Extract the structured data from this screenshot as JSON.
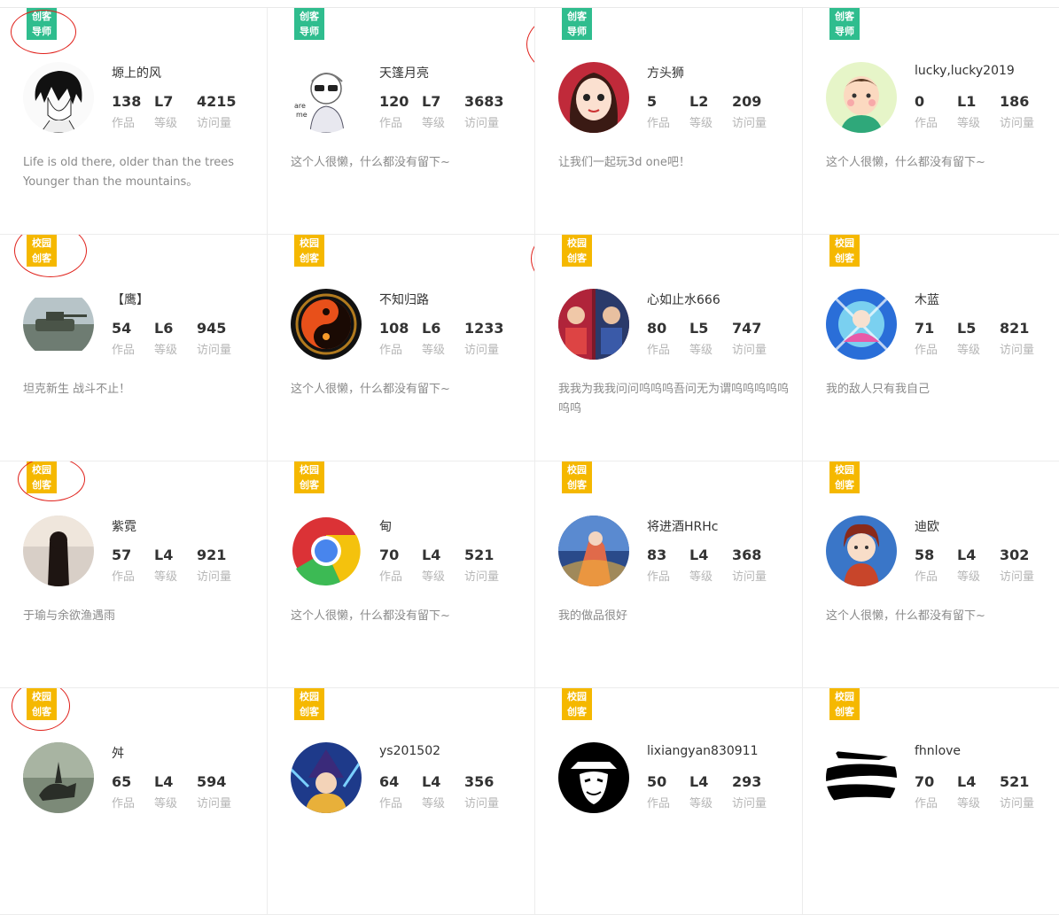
{
  "stat_labels": {
    "works": "作品",
    "level": "等级",
    "visits": "访问量"
  },
  "colors": {
    "mentor_badge": "#2fbd8e",
    "campus_badge": "#f5b800",
    "highlight_ring": "#e0211b"
  },
  "cards": [
    {
      "badge": [
        "创客",
        "导师"
      ],
      "badge_type": "mentor",
      "name": "塬上的风",
      "works": "138",
      "level": "L7",
      "visits": "4215",
      "bio": "Life is old there, older than the trees Younger than the mountains。",
      "avatar": "anime-boy"
    },
    {
      "badge": [
        "创客",
        "导师"
      ],
      "badge_type": "mentor",
      "name": "天篷月亮",
      "works": "120",
      "level": "L7",
      "visits": "3683",
      "bio": "这个人很懒，什么都没有留下~",
      "avatar": "sketch-glasses"
    },
    {
      "badge": [
        "创客",
        "导师"
      ],
      "badge_type": "mentor",
      "name": "方头狮",
      "works": "5",
      "level": "L2",
      "visits": "209",
      "bio": "让我们一起玩3d one吧！",
      "avatar": "cartoon-girl"
    },
    {
      "badge": [
        "创客",
        "导师"
      ],
      "badge_type": "mentor",
      "name": "lucky,lucky2019",
      "works": "0",
      "level": "L1",
      "visits": "186",
      "bio": "这个人很懒，什么都没有留下~",
      "avatar": "cartoon-boy"
    },
    {
      "badge": [
        "校园",
        "创客"
      ],
      "badge_type": "campus",
      "name": "【鹰】",
      "works": "54",
      "level": "L6",
      "visits": "945",
      "bio": "坦克新生 战斗不止！",
      "avatar": "tank"
    },
    {
      "badge": [
        "校园",
        "创客"
      ],
      "badge_type": "campus",
      "name": "不知归路",
      "works": "108",
      "level": "L6",
      "visits": "1233",
      "bio": "这个人很懒，什么都没有留下~",
      "avatar": "fire-yinyang"
    },
    {
      "badge": [
        "校园",
        "创客"
      ],
      "badge_type": "campus",
      "name": "心如止水666",
      "works": "80",
      "level": "L5",
      "visits": "747",
      "bio": "我我为我我问问呜呜呜吾问无为谓呜呜呜呜呜呜呜",
      "avatar": "game-poster"
    },
    {
      "badge": [
        "校园",
        "创客"
      ],
      "badge_type": "campus",
      "name": "木蓝",
      "works": "71",
      "level": "L5",
      "visits": "821",
      "bio": "我的敌人只有我自己",
      "avatar": "blue-anime"
    },
    {
      "badge": [
        "校园",
        "创客"
      ],
      "badge_type": "campus",
      "name": "紫霓",
      "works": "57",
      "level": "L4",
      "visits": "921",
      "bio": "于瑜与余欲渔遇雨",
      "avatar": "girl-back"
    },
    {
      "badge": [
        "校园",
        "创客"
      ],
      "badge_type": "campus",
      "name": "甸",
      "works": "70",
      "level": "L4",
      "visits": "521",
      "bio": "这个人很懒，什么都没有留下~",
      "avatar": "chrome-logo"
    },
    {
      "badge": [
        "校园",
        "创客"
      ],
      "badge_type": "campus",
      "name": "将进酒HRHc",
      "works": "83",
      "level": "L4",
      "visits": "368",
      "bio": "我的做品很好",
      "avatar": "sky-anime"
    },
    {
      "badge": [
        "校园",
        "创客"
      ],
      "badge_type": "campus",
      "name": "迪欧",
      "works": "58",
      "level": "L4",
      "visits": "302",
      "bio": "这个人很懒，什么都没有留下~",
      "avatar": "warrior-girl"
    },
    {
      "badge": [
        "校园",
        "创客"
      ],
      "badge_type": "campus",
      "name": "舛",
      "works": "65",
      "level": "L4",
      "visits": "594",
      "bio": "",
      "avatar": "horse-rider"
    },
    {
      "badge": [
        "校园",
        "创客"
      ],
      "badge_type": "campus",
      "name": "ys201502",
      "works": "64",
      "level": "L4",
      "visits": "356",
      "bio": "",
      "avatar": "wizard"
    },
    {
      "badge": [
        "校园",
        "创客"
      ],
      "badge_type": "campus",
      "name": "lixiangyan830911",
      "works": "50",
      "level": "L4",
      "visits": "293",
      "bio": "",
      "avatar": "v-mask"
    },
    {
      "badge": [
        "校园",
        "创客"
      ],
      "badge_type": "campus",
      "name": "fhnlove",
      "works": "70",
      "level": "L4",
      "visits": "521",
      "bio": "",
      "avatar": "ink-strokes"
    }
  ]
}
